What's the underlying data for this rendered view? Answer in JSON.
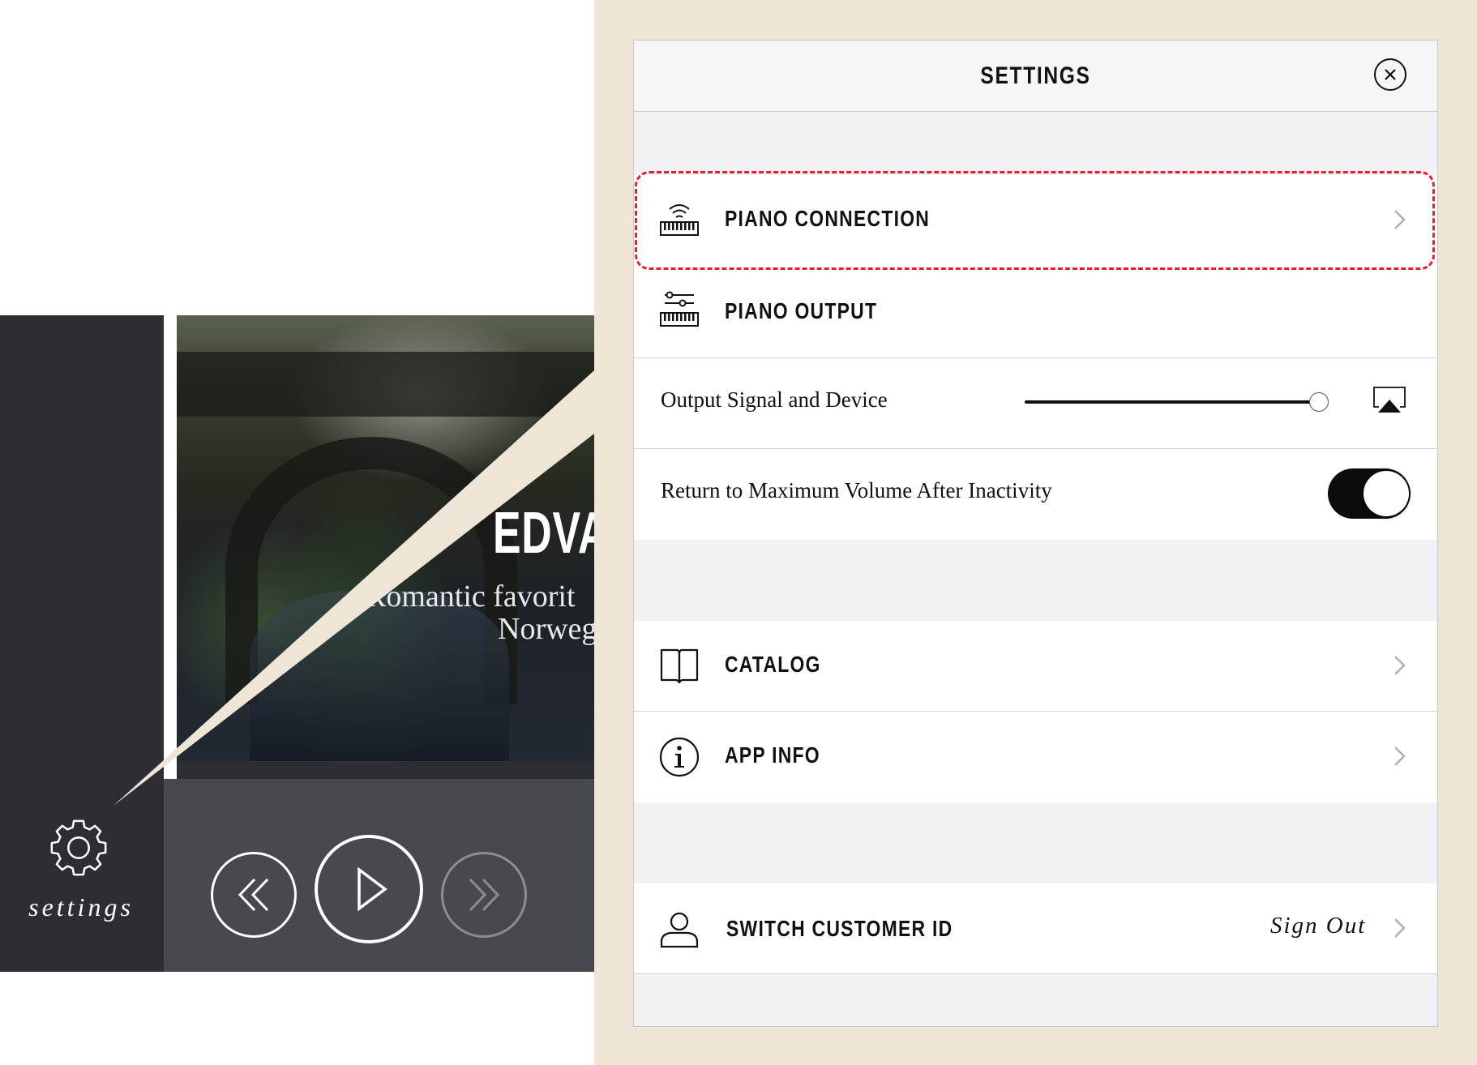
{
  "left_app": {
    "album": {
      "title": "EDVA",
      "subtitle_line1": "Romantic favorit",
      "subtitle_line2": "Norweg"
    },
    "player": {
      "prev_icon": "double-chevron-left-icon",
      "play_icon": "play-icon",
      "next_icon": "double-chevron-right-icon"
    },
    "sidebar": {
      "settings_icon": "gear-icon",
      "settings_label": "settings"
    }
  },
  "settings_panel": {
    "title": "SETTINGS",
    "close_icon": "close-icon",
    "highlight_color": "#e0202e",
    "rows": {
      "piano_connection": {
        "label": "PIANO CONNECTION",
        "icon": "piano-wifi-icon"
      },
      "piano_output": {
        "label": "PIANO OUTPUT",
        "icon": "piano-sliders-icon"
      },
      "output_signal": {
        "label": "Output Signal and Device",
        "volume_level": 0.98,
        "icon": "airplay-icon"
      },
      "return_max_volume": {
        "label": "Return to Maximum Volume After Inactivity",
        "enabled": true
      },
      "catalog": {
        "label": "CATALOG",
        "icon": "book-icon"
      },
      "app_info": {
        "label": "APP INFO",
        "icon": "info-icon"
      },
      "switch_customer_id": {
        "label": "SWITCH CUSTOMER ID",
        "action": "Sign Out",
        "icon": "user-icon"
      }
    }
  },
  "colors": {
    "backdrop": "#efe5d6",
    "sidebar": "#2d2e33",
    "player_bar": "#48494e",
    "panel_bg": "#f2f2f6",
    "toggle_on": "#0c0c0c"
  }
}
